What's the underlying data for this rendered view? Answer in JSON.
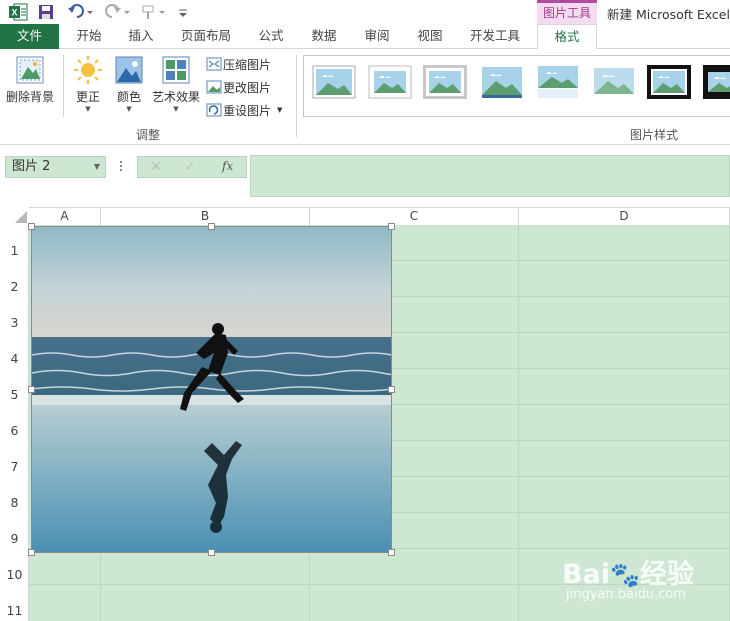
{
  "titlebar": {
    "context_group": "图片工具",
    "window_title": "新建 Microsoft Excel ..."
  },
  "tabs": [
    {
      "label": "文件"
    },
    {
      "label": "开始"
    },
    {
      "label": "插入"
    },
    {
      "label": "页面布局"
    },
    {
      "label": "公式"
    },
    {
      "label": "数据"
    },
    {
      "label": "审阅"
    },
    {
      "label": "视图"
    },
    {
      "label": "开发工具"
    },
    {
      "label": "格式"
    }
  ],
  "ribbon": {
    "remove_bg": "删除背景",
    "corrections": "更正",
    "color": "颜色",
    "artistic": "艺术效果",
    "compress": "压缩图片",
    "change": "更改图片",
    "reset": "重设图片",
    "group_adjust": "调整",
    "group_styles": "图片样式"
  },
  "formula_bar": {
    "name_box": "图片 2",
    "fx": "fx",
    "value": ""
  },
  "grid": {
    "columns": [
      "A",
      "B",
      "C",
      "D"
    ],
    "rows": [
      "1",
      "2",
      "3",
      "4",
      "5",
      "6",
      "7",
      "8",
      "9",
      "10",
      "11"
    ]
  },
  "watermark": {
    "brand": "Bai",
    "brand2": "经验",
    "url": "jingyan.baidu.com"
  },
  "colors": {
    "excel_green": "#217346",
    "cell_fill": "#cde7d2",
    "context_tab": "#b04a9c"
  }
}
